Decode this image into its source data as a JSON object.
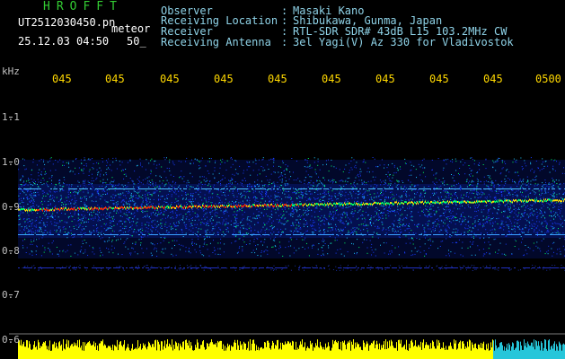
{
  "header": {
    "title": "HROFFT",
    "filename": "UT2512030450.pn",
    "tag": "meteor",
    "datetime": "25.12.03 04:50",
    "bandwidth": "50_",
    "fields": [
      {
        "label": "Observer",
        "value": "Masaki Kano"
      },
      {
        "label": "Receiving Location",
        "value": "Shibukawa, Gunma, Japan"
      },
      {
        "label": "Receiver",
        "value": "RTL-SDR SDR# 43dB L15 103.2MHz CW"
      },
      {
        "label": "Receiving Antenna",
        "value": "3el Yagi(V) Az 330 for Vladivostok"
      }
    ]
  },
  "axes": {
    "y_unit": "kHz",
    "y_labels": [
      "1.1",
      "1.0",
      "0.9",
      "0.8",
      "0.7",
      "0.6"
    ],
    "x_labels": [
      "045",
      "045",
      "045",
      "045",
      "045",
      "045",
      "045",
      "045",
      "045",
      "0500"
    ]
  },
  "colors": {
    "title": "#33cc33",
    "header_text": "#8fd3e8",
    "time_labels": "#ffd800",
    "signal_strong": "#ff2a00",
    "signal_mid": "#00ff66",
    "noise": "#1a3cff",
    "level_bar": "#ffff00"
  }
}
